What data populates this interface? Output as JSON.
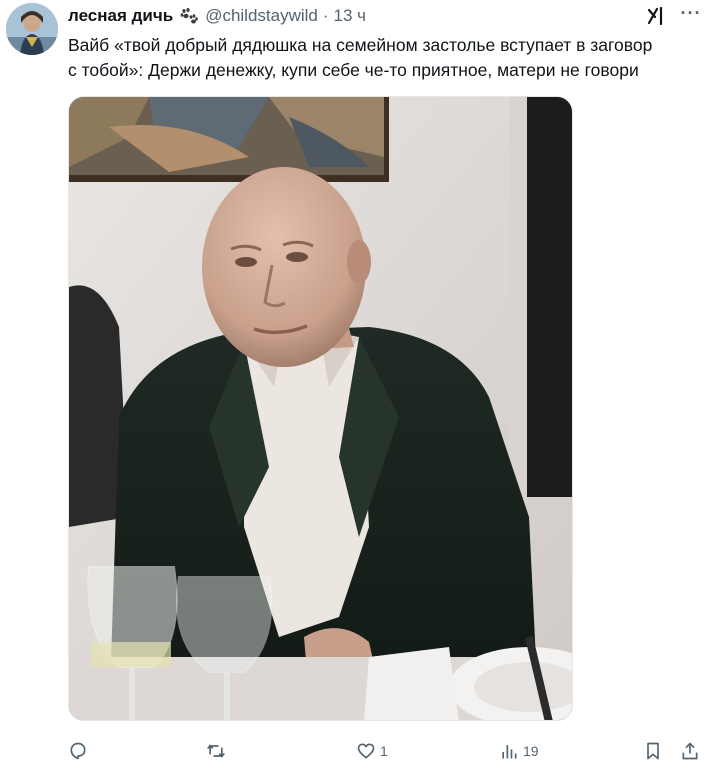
{
  "author": {
    "display_name": "лесная дичь",
    "handle": "@childstaywild",
    "separator": "·",
    "time": "13 ч"
  },
  "icons": {
    "name_emoji": "paw-prints-icon",
    "grok": "grok-icon",
    "more": "more-icon"
  },
  "more_label": "···",
  "text": {
    "line1": "Вайб «твой добрый дядюшка на семейном застолье вступает в заговор",
    "line2": "с тобой»: Держи денежку, купи себе че-то приятное, матери не говори"
  },
  "actions": {
    "reply_count": "",
    "retweet_count": "",
    "like_count": "1",
    "views_count": "19"
  },
  "colors": {
    "text": "#0f1419",
    "secondary": "#536471"
  }
}
